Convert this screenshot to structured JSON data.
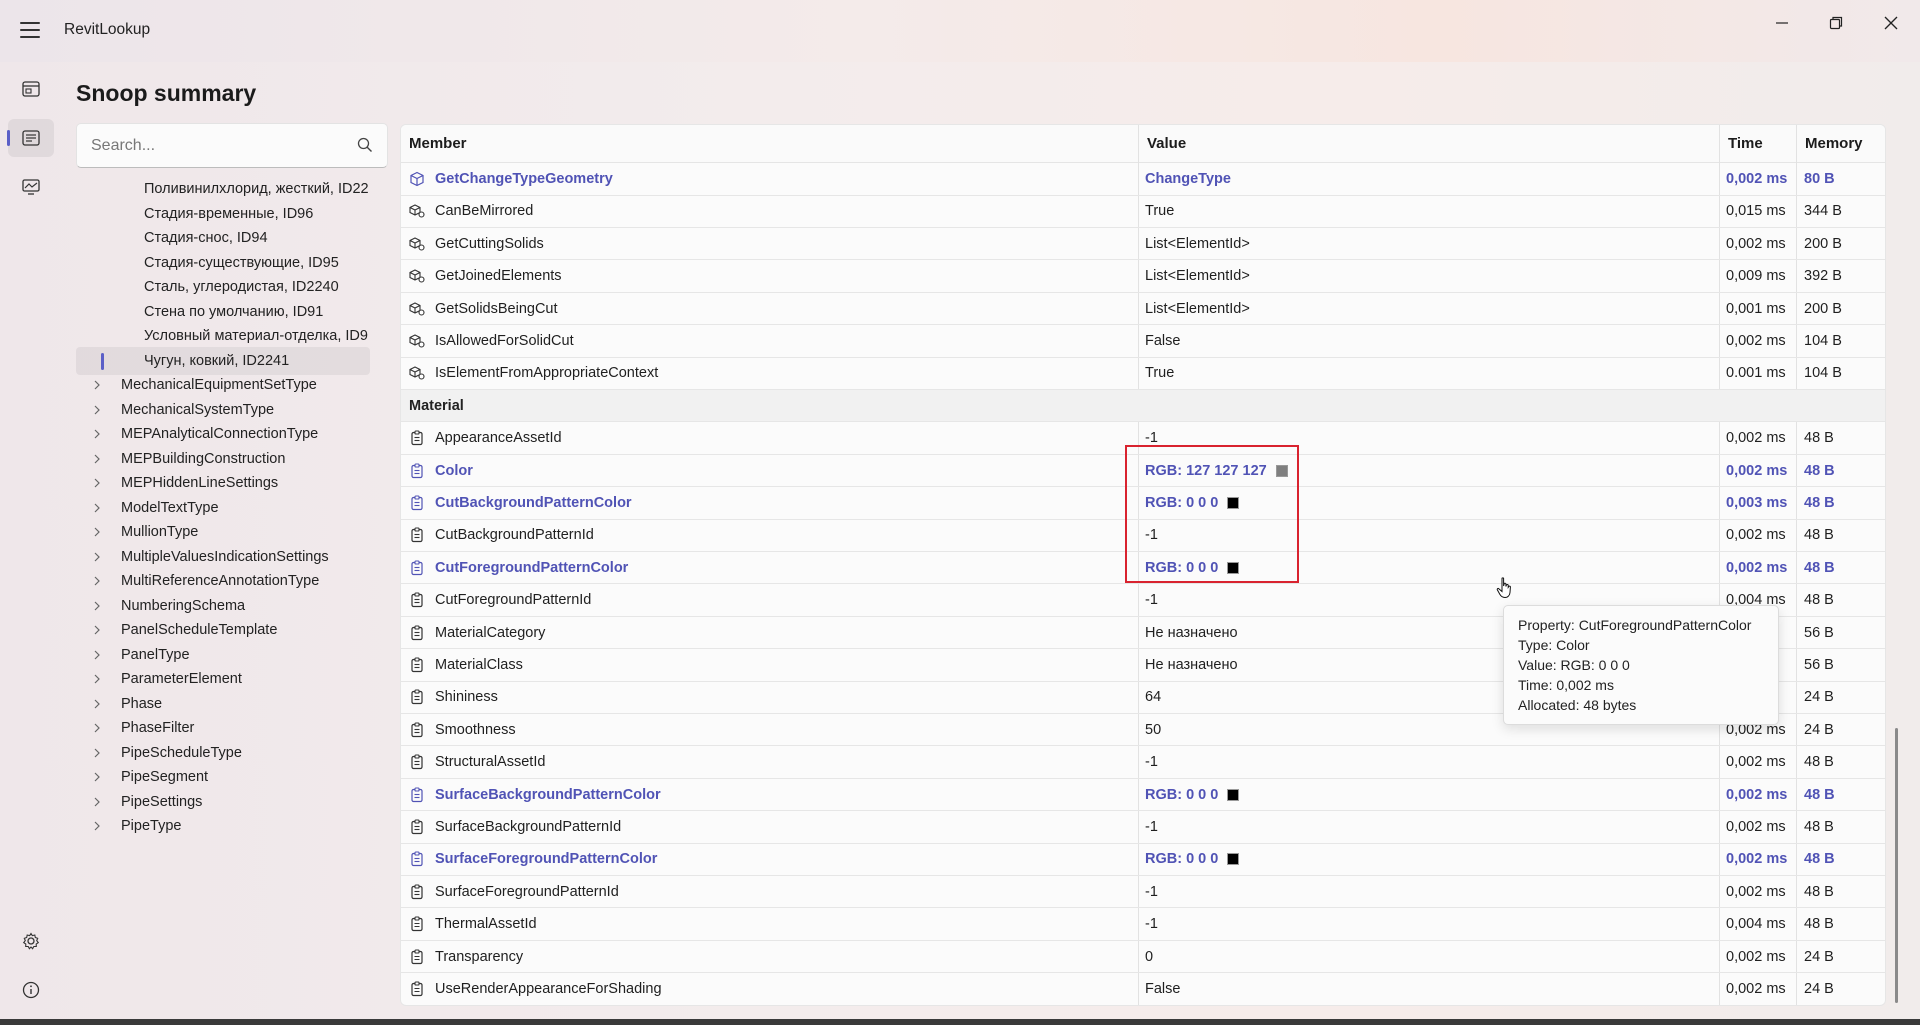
{
  "app": {
    "title": "RevitLookup"
  },
  "page": {
    "title": "Snoop summary"
  },
  "search": {
    "placeholder": "Search..."
  },
  "tree": {
    "items": [
      {
        "label": "Поливинилхлорид, жесткий, ID22",
        "kind": "child"
      },
      {
        "label": "Стадия-временные, ID96",
        "kind": "child"
      },
      {
        "label": "Стадия-снос, ID94",
        "kind": "child"
      },
      {
        "label": "Стадия-существующие, ID95",
        "kind": "child"
      },
      {
        "label": "Сталь, углеродистая, ID2240",
        "kind": "child"
      },
      {
        "label": "Стена по умолчанию, ID91",
        "kind": "child"
      },
      {
        "label": "Условный материал-отделка, ID9",
        "kind": "child"
      },
      {
        "label": "Чугун, ковкий, ID2241",
        "kind": "child",
        "selected": true
      },
      {
        "label": "MechanicalEquipmentSetType",
        "kind": "parent"
      },
      {
        "label": "MechanicalSystemType",
        "kind": "parent"
      },
      {
        "label": "MEPAnalyticalConnectionType",
        "kind": "parent"
      },
      {
        "label": "MEPBuildingConstruction",
        "kind": "parent"
      },
      {
        "label": "MEPHiddenLineSettings",
        "kind": "parent"
      },
      {
        "label": "ModelTextType",
        "kind": "parent"
      },
      {
        "label": "MullionType",
        "kind": "parent"
      },
      {
        "label": "MultipleValuesIndicationSettings",
        "kind": "parent"
      },
      {
        "label": "MultiReferenceAnnotationType",
        "kind": "parent"
      },
      {
        "label": "NumberingSchema",
        "kind": "parent"
      },
      {
        "label": "PanelScheduleTemplate",
        "kind": "parent"
      },
      {
        "label": "PanelType",
        "kind": "parent"
      },
      {
        "label": "ParameterElement",
        "kind": "parent"
      },
      {
        "label": "Phase",
        "kind": "parent"
      },
      {
        "label": "PhaseFilter",
        "kind": "parent"
      },
      {
        "label": "PipeScheduleType",
        "kind": "parent"
      },
      {
        "label": "PipeSegment",
        "kind": "parent"
      },
      {
        "label": "PipeSettings",
        "kind": "parent"
      },
      {
        "label": "PipeType",
        "kind": "parent"
      }
    ]
  },
  "grid": {
    "columns": {
      "member": "Member",
      "value": "Value",
      "time": "Time",
      "memory": "Memory"
    },
    "rows": [
      {
        "member": "GetChangeTypeGeometry",
        "value": "ChangeType",
        "time": "0,002 ms",
        "memory": "80 B",
        "style": "link",
        "icon": "cube-icon"
      },
      {
        "member": "CanBeMirrored",
        "value": "True",
        "time": "0,015 ms",
        "memory": "344 B",
        "icon": "method-icon"
      },
      {
        "member": "GetCuttingSolids",
        "value": "List<ElementId>",
        "time": "0,002 ms",
        "memory": "200 B",
        "icon": "method-icon"
      },
      {
        "member": "GetJoinedElements",
        "value": "List<ElementId>",
        "time": "0,009 ms",
        "memory": "392 B",
        "icon": "method-icon"
      },
      {
        "member": "GetSolidsBeingCut",
        "value": "List<ElementId>",
        "time": "0,001 ms",
        "memory": "200 B",
        "icon": "method-icon"
      },
      {
        "member": "IsAllowedForSolidCut",
        "value": "False",
        "time": "0,002 ms",
        "memory": "104 B",
        "icon": "method-icon"
      },
      {
        "member": "IsElementFromAppropriateContext",
        "value": "True",
        "time": "0.001 ms",
        "memory": "104 B",
        "icon": "method-icon"
      },
      {
        "member": "Material",
        "value": "",
        "time": "",
        "memory": "",
        "style": "group"
      },
      {
        "member": "AppearanceAssetId",
        "value": "-1",
        "time": "0,002 ms",
        "memory": "48 B",
        "icon": "property-icon"
      },
      {
        "member": "Color",
        "value": "RGB: 127 127 127",
        "time": "0,002 ms",
        "memory": "48 B",
        "style": "link",
        "icon": "property-icon",
        "swatch": "#7f7f7f"
      },
      {
        "member": "CutBackgroundPatternColor",
        "value": "RGB: 0 0 0",
        "time": "0,003 ms",
        "memory": "48 B",
        "style": "link",
        "icon": "property-icon",
        "swatch": "#000000"
      },
      {
        "member": "CutBackgroundPatternId",
        "value": "-1",
        "time": "0,002 ms",
        "memory": "48 B",
        "icon": "property-icon"
      },
      {
        "member": "CutForegroundPatternColor",
        "value": "RGB: 0 0 0",
        "time": "0,002 ms",
        "memory": "48 B",
        "style": "link",
        "icon": "property-icon",
        "swatch": "#000000"
      },
      {
        "member": "CutForegroundPatternId",
        "value": "-1",
        "time": "0,004 ms",
        "memory": "48 B",
        "icon": "property-icon"
      },
      {
        "member": "MaterialCategory",
        "value": "Не назначено",
        "time": "",
        "memory": "56 B",
        "icon": "property-icon"
      },
      {
        "member": "MaterialClass",
        "value": "Не назначено",
        "time": "",
        "memory": "56 B",
        "icon": "property-icon"
      },
      {
        "member": "Shininess",
        "value": "64",
        "time": "",
        "memory": "24 B",
        "icon": "property-icon"
      },
      {
        "member": "Smoothness",
        "value": "50",
        "time": "0,002 ms",
        "memory": "24 B",
        "icon": "property-icon"
      },
      {
        "member": "StructuralAssetId",
        "value": "-1",
        "time": "0,002 ms",
        "memory": "48 B",
        "icon": "property-icon"
      },
      {
        "member": "SurfaceBackgroundPatternColor",
        "value": "RGB: 0 0 0",
        "time": "0,002 ms",
        "memory": "48 B",
        "style": "link",
        "icon": "property-icon",
        "swatch": "#000000"
      },
      {
        "member": "SurfaceBackgroundPatternId",
        "value": "-1",
        "time": "0,002 ms",
        "memory": "48 B",
        "icon": "property-icon"
      },
      {
        "member": "SurfaceForegroundPatternColor",
        "value": "RGB: 0 0 0",
        "time": "0,002 ms",
        "memory": "48 B",
        "style": "link",
        "icon": "property-icon",
        "swatch": "#000000"
      },
      {
        "member": "SurfaceForegroundPatternId",
        "value": "-1",
        "time": "0,002 ms",
        "memory": "48 B",
        "icon": "property-icon"
      },
      {
        "member": "ThermalAssetId",
        "value": "-1",
        "time": "0,004 ms",
        "memory": "48 B",
        "icon": "property-icon"
      },
      {
        "member": "Transparency",
        "value": "0",
        "time": "0,002 ms",
        "memory": "24 B",
        "icon": "property-icon"
      },
      {
        "member": "UseRenderAppearanceForShading",
        "value": "False",
        "time": "0,002 ms",
        "memory": "24 B",
        "icon": "property-icon"
      }
    ]
  },
  "tooltip": {
    "property": "Property: CutForegroundPatternColor",
    "type": "Type: Color",
    "value": "Value: RGB: 0 0 0",
    "time": "Time: 0,002 ms",
    "allocated": "Allocated: 48 bytes"
  },
  "colors": {
    "accent": "#5b5fc7",
    "link": "#5053b5",
    "highlight": "#d9232f"
  }
}
